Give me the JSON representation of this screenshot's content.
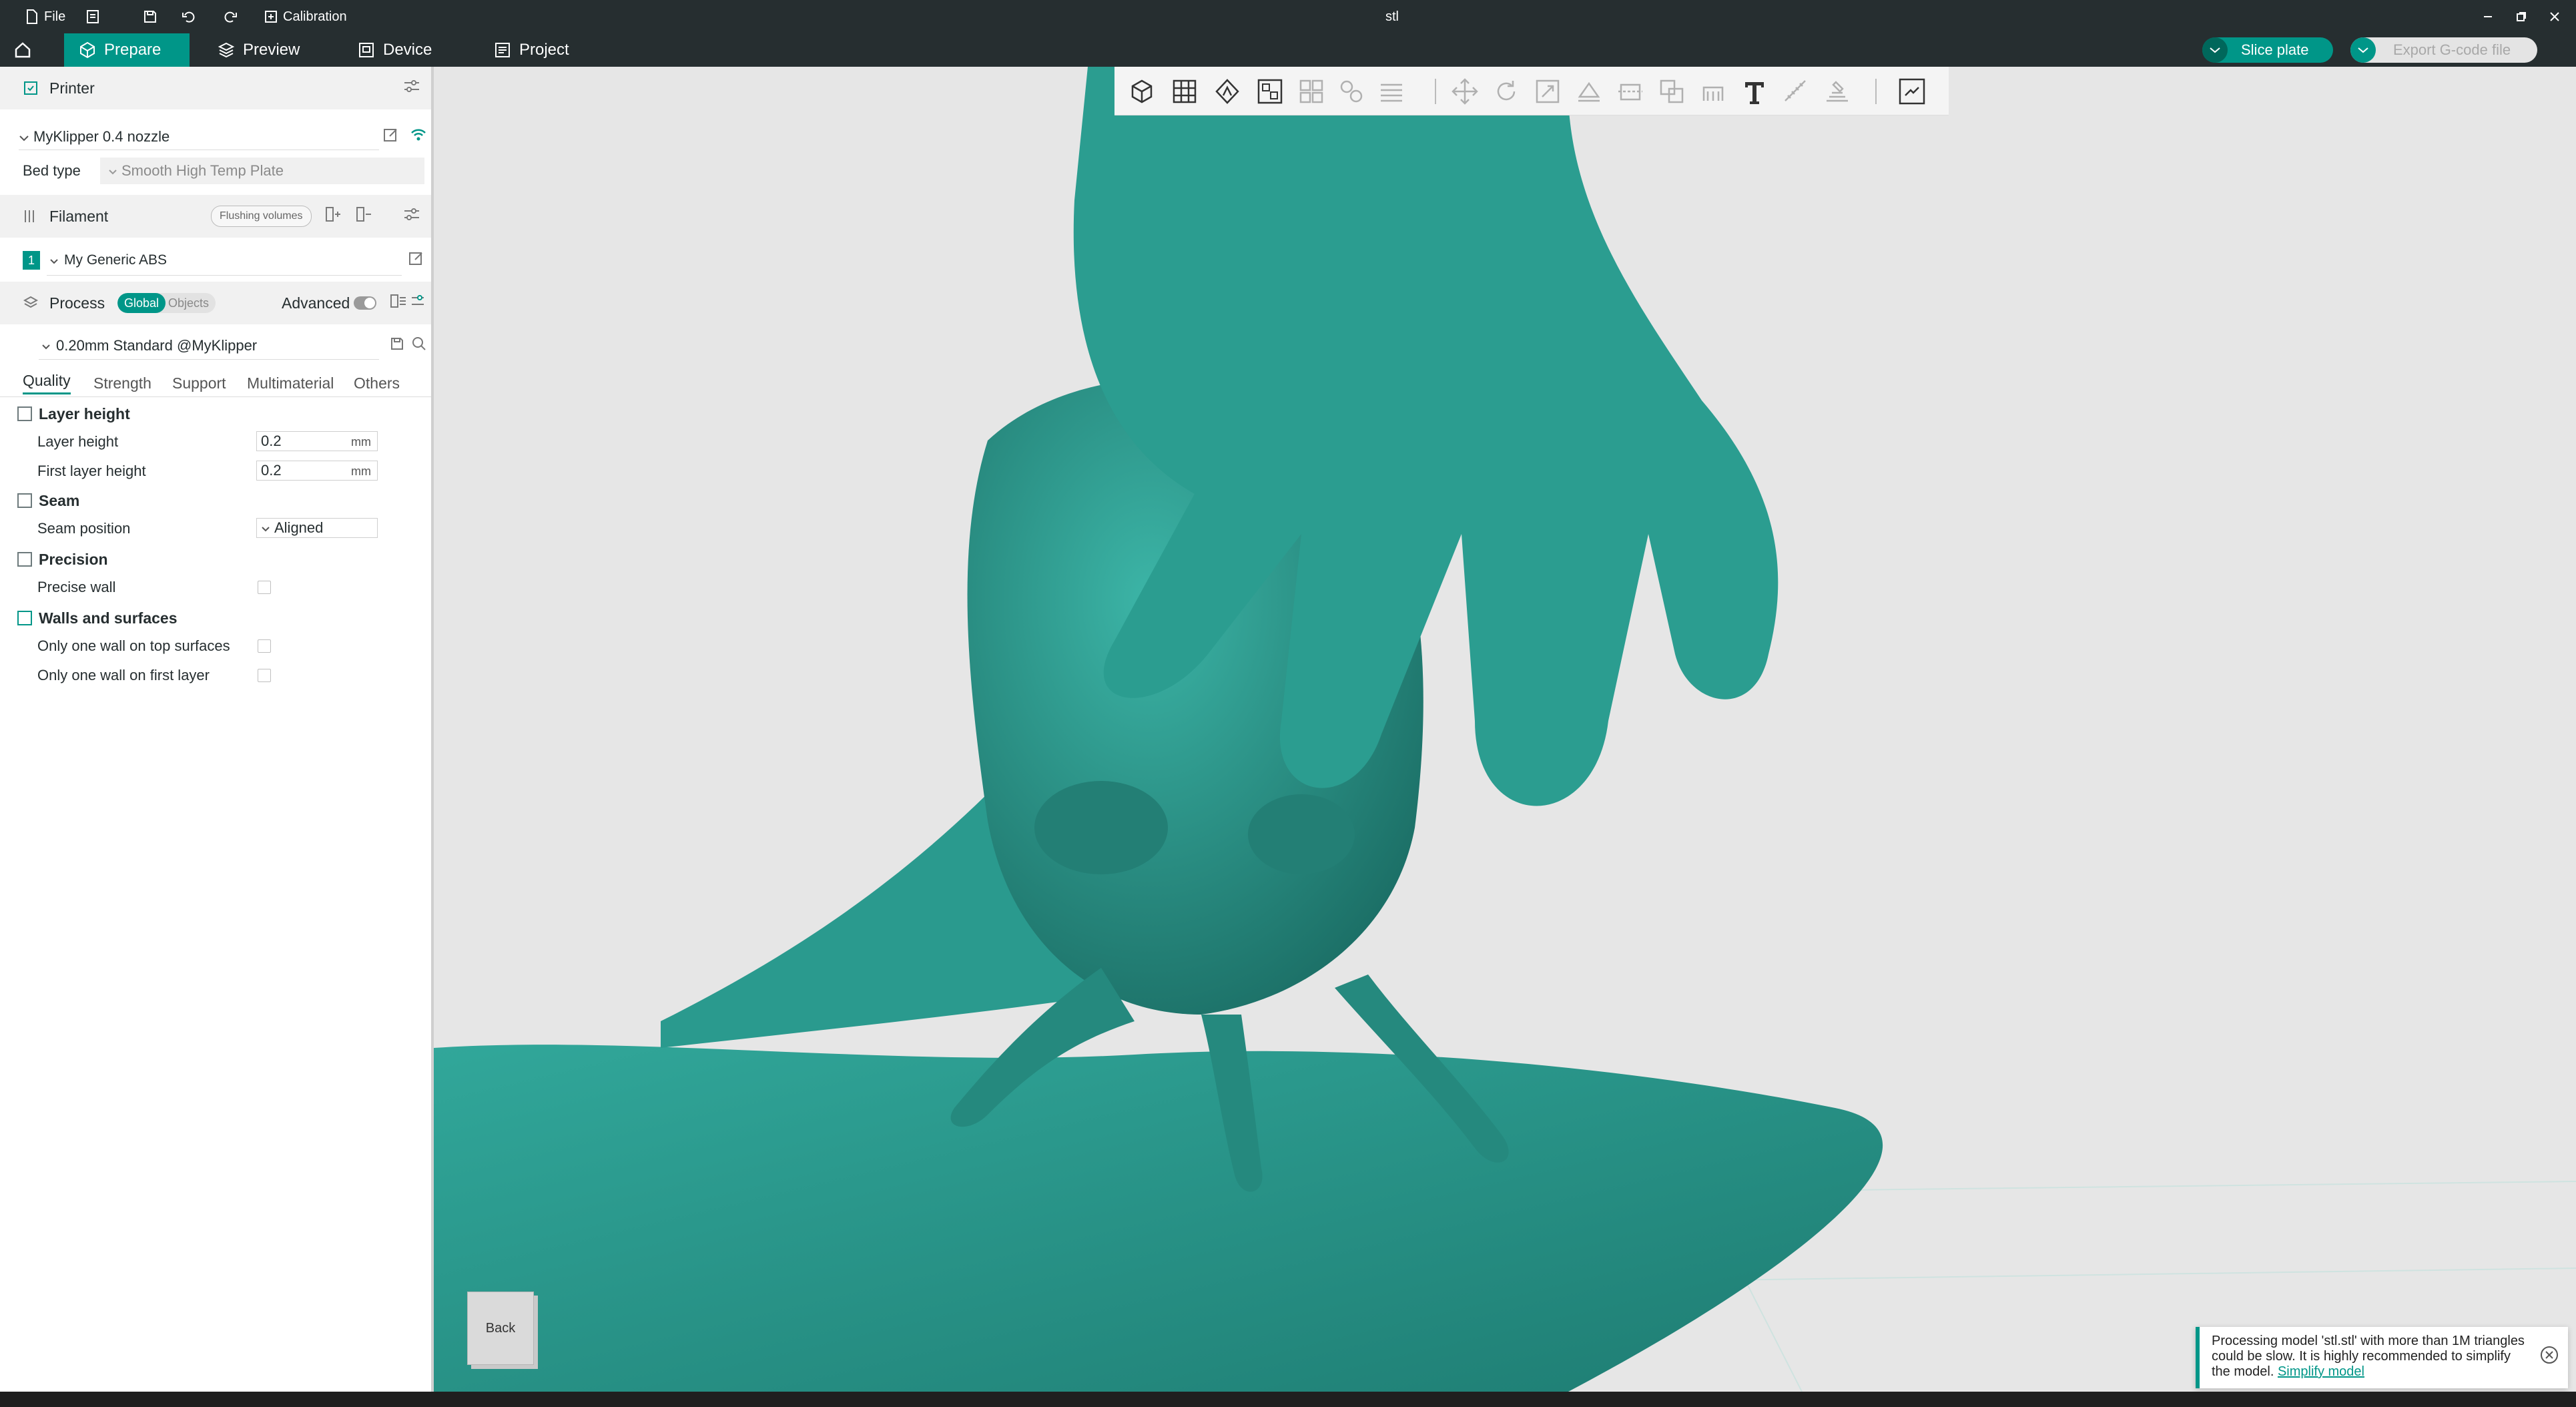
{
  "title_bar": {
    "file_label": "File",
    "calibration_label": "Calibration",
    "window_title": "stl"
  },
  "tabs": [
    {
      "label": "Prepare"
    },
    {
      "label": "Preview"
    },
    {
      "label": "Device"
    },
    {
      "label": "Project"
    }
  ],
  "actions": {
    "slice_label": "Slice plate",
    "export_label": "Export G-code file"
  },
  "printer": {
    "header": "Printer",
    "name": "MyKlipper 0.4 nozzle",
    "bed_type_label": "Bed type",
    "bed_type_value": "Smooth High Temp Plate"
  },
  "filament": {
    "header": "Filament",
    "flushing_label": "Flushing volumes",
    "slot_number": "1",
    "name": "My Generic ABS"
  },
  "process": {
    "header": "Process",
    "global_label": "Global",
    "objects_label": "Objects",
    "advanced_label": "Advanced",
    "profile": "0.20mm Standard @MyKlipper"
  },
  "process_tabs": [
    {
      "label": "Quality"
    },
    {
      "label": "Strength"
    },
    {
      "label": "Support"
    },
    {
      "label": "Multimaterial"
    },
    {
      "label": "Others"
    }
  ],
  "settings": {
    "layer_height_section": "Layer height",
    "layer_height_label": "Layer height",
    "layer_height_value": "0.2",
    "first_layer_height_label": "First layer height",
    "first_layer_height_value": "0.2",
    "unit": "mm",
    "seam_section": "Seam",
    "seam_position_label": "Seam position",
    "seam_position_value": "Aligned",
    "precision_section": "Precision",
    "precise_wall_label": "Precise wall",
    "walls_section": "Walls and surfaces",
    "one_wall_top_label": "Only one wall on top surfaces",
    "one_wall_first_label": "Only one wall on first layer"
  },
  "viewport": {
    "nav_cube_label": "Back"
  },
  "notification": {
    "message": "Processing model 'stl.stl' with more than 1M triangles could be slow. It is highly recommended to simplify the model.",
    "link": "Simplify model"
  },
  "colors": {
    "accent": "#009688",
    "titlebar": "#262e30",
    "model": "#2a9a8e"
  }
}
